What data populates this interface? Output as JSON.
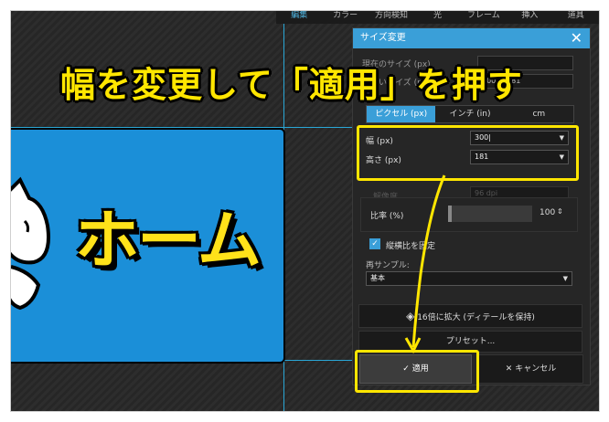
{
  "menu": [
    "編集",
    "カラー",
    "方向検知",
    "光",
    "フレーム",
    "挿入",
    "道具"
  ],
  "headline": "幅を変更して「適用」を押す",
  "canvas": {
    "text": "ホーム"
  },
  "dialog": {
    "title": "サイズ変更",
    "hidden_rows": [
      {
        "label": "現在のサイズ (px)",
        "value": ""
      },
      {
        "label": "新しいサイズ (px)",
        "value": "300 × 181"
      }
    ],
    "unit_tabs": [
      "ピクセル (px)",
      "インチ (in)",
      "cm"
    ],
    "width_label": "幅 (px)",
    "width_value": "300",
    "height_label": "高さ (px)",
    "height_value": "181",
    "resolution_label": "解像度",
    "resolution_value": "96 dpi",
    "ratio_label": "比率 (%)",
    "ratio_value": "100",
    "keep_aspect_label": "縦横比を固定",
    "resample_label": "再サンプル:",
    "resample_value": "基本",
    "upscale_label": "16倍に拡大 (ディテールを保持)",
    "preset_label": "プリセット...",
    "apply_label": "適用",
    "cancel_label": "キャンセル"
  },
  "colors": {
    "accent": "#3a9fd8",
    "highlight": "#ffe600"
  }
}
